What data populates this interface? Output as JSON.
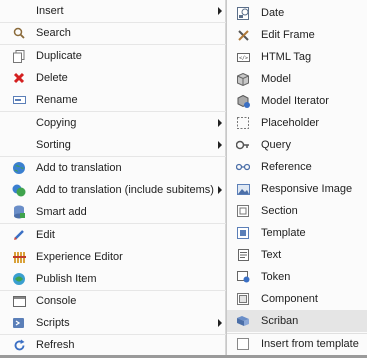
{
  "left_menu": {
    "items": [
      {
        "label": "Insert",
        "icon": "none",
        "submenu": true
      },
      {
        "label": "Search",
        "icon": "search-icon",
        "submenu": false
      },
      {
        "label": "Duplicate",
        "icon": "duplicate-icon",
        "submenu": false
      },
      {
        "label": "Delete",
        "icon": "delete-icon",
        "submenu": false
      },
      {
        "label": "Rename",
        "icon": "rename-icon",
        "submenu": false
      },
      {
        "label": "Copying",
        "icon": "none",
        "submenu": true
      },
      {
        "label": "Sorting",
        "icon": "none",
        "submenu": true
      },
      {
        "label": "Add to translation",
        "icon": "translation-icon",
        "submenu": false
      },
      {
        "label": "Add to translation (include subitems)",
        "icon": "translation-subitems-icon",
        "submenu": false
      },
      {
        "label": "Smart add",
        "icon": "smart-add-icon",
        "submenu": false
      },
      {
        "label": "Edit",
        "icon": "edit-icon",
        "submenu": false
      },
      {
        "label": "Experience Editor",
        "icon": "experience-editor-icon",
        "submenu": false
      },
      {
        "label": "Publish Item",
        "icon": "publish-icon",
        "submenu": false
      },
      {
        "label": "Console",
        "icon": "console-icon",
        "submenu": false
      },
      {
        "label": "Scripts",
        "icon": "scripts-icon",
        "submenu": true
      },
      {
        "label": "Refresh",
        "icon": "refresh-icon",
        "submenu": false
      }
    ]
  },
  "insert_submenu": {
    "items": [
      {
        "label": "Date",
        "icon": "date-icon"
      },
      {
        "label": "Edit Frame",
        "icon": "edit-frame-icon"
      },
      {
        "label": "HTML Tag",
        "icon": "html-tag-icon"
      },
      {
        "label": "Model",
        "icon": "model-icon"
      },
      {
        "label": "Model Iterator",
        "icon": "model-iterator-icon"
      },
      {
        "label": "Placeholder",
        "icon": "placeholder-icon"
      },
      {
        "label": "Query",
        "icon": "query-icon"
      },
      {
        "label": "Reference",
        "icon": "reference-icon"
      },
      {
        "label": "Responsive Image",
        "icon": "responsive-image-icon"
      },
      {
        "label": "Section",
        "icon": "section-icon"
      },
      {
        "label": "Template",
        "icon": "template-icon"
      },
      {
        "label": "Text",
        "icon": "text-icon"
      },
      {
        "label": "Token",
        "icon": "token-icon"
      },
      {
        "label": "Component",
        "icon": "component-icon"
      },
      {
        "label": "Scriban",
        "icon": "scriban-icon"
      },
      {
        "label": "Insert from template",
        "icon": "insert-template-icon"
      }
    ],
    "selected": "Scriban"
  },
  "colors": {
    "menu_bg": "#fbfbfb",
    "selected_bg": "#e5e5e5",
    "delete_red": "#d42020",
    "link_blue": "#3a6fc4"
  }
}
